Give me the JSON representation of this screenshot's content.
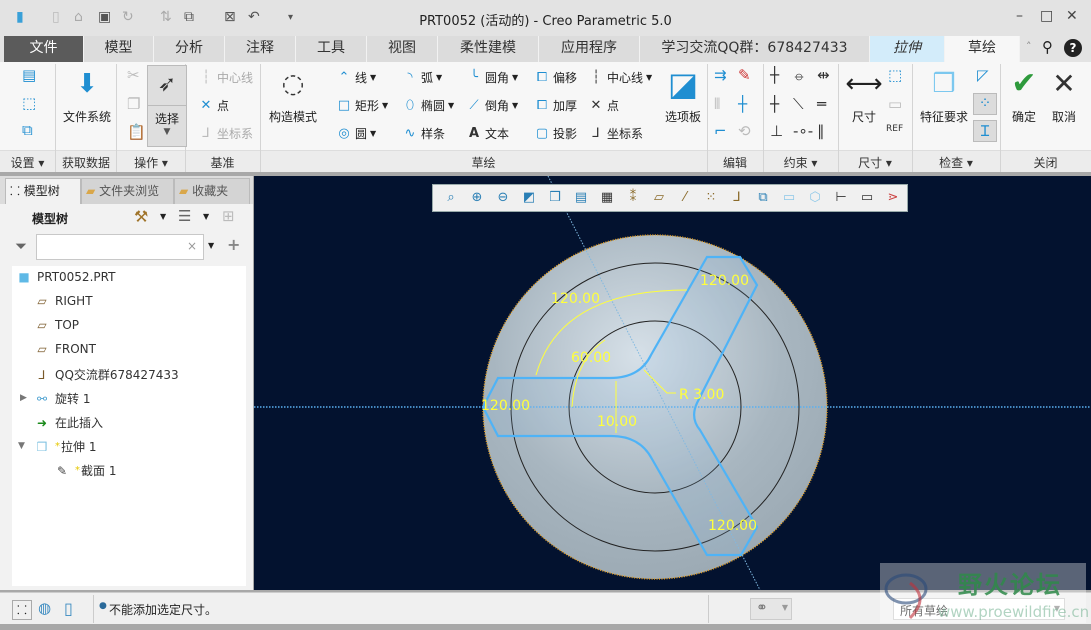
{
  "window": {
    "title": "PRT0052 (活动的) - Creo Parametric 5.0",
    "min": "–",
    "max": "□",
    "close": "✕"
  },
  "tabs": [
    {
      "label": "文件"
    },
    {
      "label": "模型"
    },
    {
      "label": "分析"
    },
    {
      "label": "注释"
    },
    {
      "label": "工具"
    },
    {
      "label": "视图"
    },
    {
      "label": "柔性建模"
    },
    {
      "label": "应用程序"
    },
    {
      "label": "学习交流QQ群：678427433"
    },
    {
      "label": "拉伸"
    },
    {
      "label": "草绘"
    }
  ],
  "ribbon": {
    "groups": [
      "设置",
      "获取数据",
      "操作",
      "基准",
      "草绘",
      "编辑",
      "约束",
      "尺寸",
      "检查",
      "关闭"
    ],
    "file_system": "文件系统",
    "select": "选择",
    "datum": {
      "centerline": "中心线",
      "point": "点",
      "coordsys": "坐标系"
    },
    "construction_mode": "构造模式",
    "sketch": {
      "line": "线",
      "arc": "弧",
      "fillet": "圆角",
      "offset": "偏移",
      "centerline": "中心线",
      "rect": "矩形",
      "ellipse": "椭圆",
      "chamfer": "倒角",
      "thicken": "加厚",
      "point": "点",
      "circle": "圆",
      "spline": "样条",
      "text": "文本",
      "project": "投影",
      "coordsys": "坐标系"
    },
    "palette": "选项板",
    "dimension": "尺寸",
    "feature_req": "特征要求",
    "ok": "确定",
    "cancel": "取消"
  },
  "panel": {
    "tabs": [
      "模型树",
      "文件夹浏览",
      "收藏夹"
    ],
    "header": "模型树",
    "filter_value": "",
    "tree": [
      {
        "label": "PRT0052.PRT",
        "icon": "part-icon"
      },
      {
        "label": "RIGHT",
        "icon": "datum-plane-icon"
      },
      {
        "label": "TOP",
        "icon": "datum-plane-icon"
      },
      {
        "label": "FRONT",
        "icon": "datum-plane-icon"
      },
      {
        "label": "QQ交流群678427433",
        "icon": "coordsys-icon"
      },
      {
        "label": "旋转 1",
        "icon": "revolve-icon"
      },
      {
        "label": "在此插入",
        "icon": "insert-here-icon"
      },
      {
        "label": "拉伸 1",
        "icon": "extrude-icon",
        "marker": "*"
      },
      {
        "label": "截面 1",
        "icon": "sketch-icon",
        "marker": "*"
      }
    ]
  },
  "sketch_dims": [
    "120.00",
    "120.00",
    "60.00",
    "R 3.00",
    "120.00",
    "10.00",
    "120.00"
  ],
  "colors": {
    "canvas": "#03122f",
    "sketch": "#4fb3f6",
    "dimension": "#ffff3c",
    "accent": "#1f8ed1"
  },
  "status": {
    "message": "不能添加选定尺寸。",
    "filter": "所有草绘"
  },
  "watermark": {
    "title": "野火论坛",
    "url": "www.proewildfire.cn"
  }
}
